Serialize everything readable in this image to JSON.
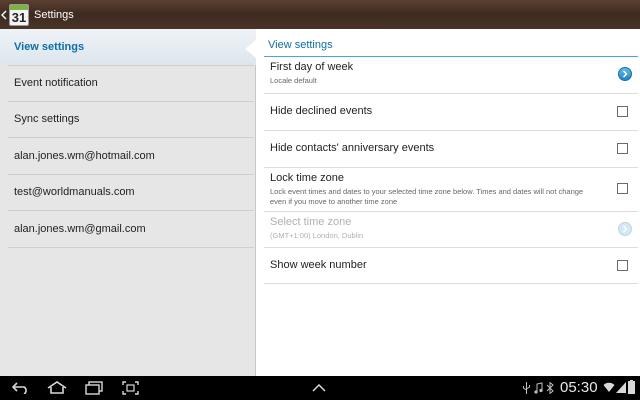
{
  "action_bar": {
    "icon_number": "31",
    "title": "Settings"
  },
  "left_menu": {
    "items": [
      {
        "label": "View settings",
        "active": true
      },
      {
        "label": "Event notification"
      },
      {
        "label": "Sync settings"
      },
      {
        "label": "alan.jones.wm@hotmail.com"
      },
      {
        "label": "test@worldmanuals.com"
      },
      {
        "label": "alan.jones.wm@gmail.com"
      }
    ]
  },
  "right_pane": {
    "section_title": "View settings",
    "rows": [
      {
        "title": "First day of week",
        "subtitle": "Locale default",
        "control": "chevron",
        "enabled": true
      },
      {
        "title": "Hide declined events",
        "control": "checkbox",
        "checked": false
      },
      {
        "title": "Hide contacts' anniversary events",
        "control": "checkbox",
        "checked": false
      },
      {
        "title": "Lock time zone",
        "subtitle": "Lock event times and dates to your selected time zone below. Times and dates will not change even if you move to another time zone",
        "control": "checkbox",
        "checked": false
      },
      {
        "title": "Select time zone",
        "subtitle": "(GMT+1:00) London, Dublin",
        "control": "chevron",
        "enabled": false
      },
      {
        "title": "Show week number",
        "control": "checkbox",
        "checked": false
      }
    ]
  },
  "system_bar": {
    "clock": "05:30",
    "icons": [
      "back-icon",
      "home-icon",
      "recent-apps-icon",
      "screenshot-icon",
      "up-chevron-icon",
      "usb-icon",
      "music-icon",
      "bluetooth-icon",
      "wifi-icon",
      "signal-icon",
      "battery-icon"
    ]
  },
  "colors": {
    "accent": "#0f6ea6",
    "action_bar": "#4a3428",
    "chevron_button": "#1f86c3"
  }
}
